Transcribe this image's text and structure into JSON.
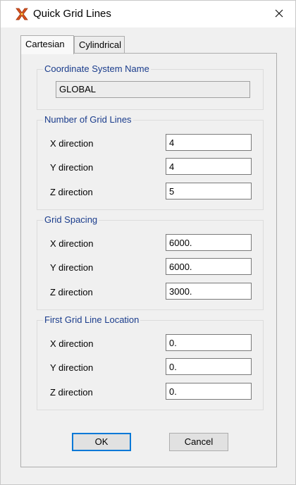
{
  "window": {
    "title": "Quick Grid Lines",
    "icon": "quick-grid-app-icon",
    "close_icon": "close-icon"
  },
  "tabs": [
    {
      "label": "Cartesian",
      "active": true
    },
    {
      "label": "Cylindrical",
      "active": false
    }
  ],
  "coordinate_system": {
    "title": "Coordinate System Name",
    "value": "GLOBAL"
  },
  "number_of_grid_lines": {
    "title": "Number of Grid Lines",
    "x_label": "X direction",
    "x_value": "4",
    "y_label": "Y direction",
    "y_value": "4",
    "z_label": "Z direction",
    "z_value": "5"
  },
  "grid_spacing": {
    "title": "Grid Spacing",
    "x_label": "X direction",
    "x_value": "6000.",
    "y_label": "Y direction",
    "y_value": "6000.",
    "z_label": "Z direction",
    "z_value": "3000."
  },
  "first_grid_line_location": {
    "title": "First Grid Line Location",
    "x_label": "X direction",
    "x_value": "0.",
    "y_label": "Y direction",
    "y_value": "0.",
    "z_label": "Z direction",
    "z_value": "0."
  },
  "buttons": {
    "ok": "OK",
    "cancel": "Cancel"
  },
  "colors": {
    "group_title": "#1a3c8c",
    "default_button_border": "#0078d7"
  }
}
